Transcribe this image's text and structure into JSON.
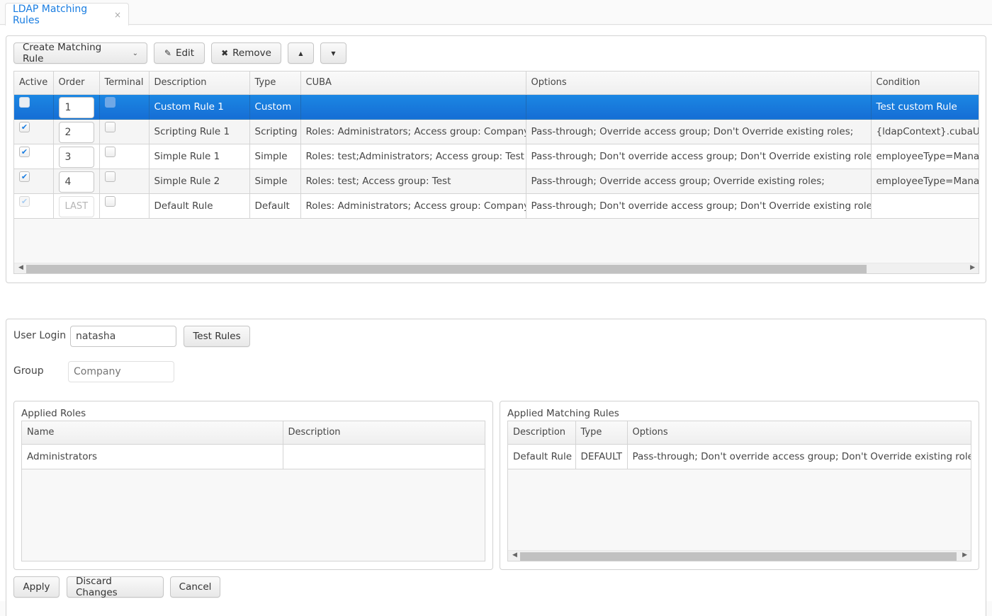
{
  "tab": {
    "label": "LDAP Matching Rules",
    "close_icon": "×"
  },
  "toolbar": {
    "create_label": "Create Matching Rule",
    "edit_label": "Edit",
    "remove_label": "Remove",
    "move_up_icon": "▲",
    "move_down_icon": "▼",
    "chevron_icon": "⌄",
    "pencil_icon": "✎",
    "x_icon": "✖"
  },
  "rules_table": {
    "columns": [
      "Active",
      "Order",
      "Terminal",
      "Description",
      "Type",
      "CUBA",
      "Options",
      "Condition"
    ],
    "rows": [
      {
        "active": false,
        "order": "1",
        "terminal": false,
        "description": "Custom Rule 1",
        "type": "Custom",
        "cuba": "",
        "options": "",
        "condition": "Test custom Rule",
        "selected": true
      },
      {
        "active": true,
        "order": "2",
        "terminal": false,
        "description": "Scripting Rule 1",
        "type": "Scripting",
        "cuba": "Roles: Administrators; Access group: Company",
        "options": "Pass-through; Override access group; Don't Override existing roles;",
        "condition": "{ldapContext}.cubaUser"
      },
      {
        "active": true,
        "order": "3",
        "terminal": false,
        "description": "Simple Rule 1",
        "type": "Simple",
        "cuba": "Roles: test;Administrators; Access group: Test",
        "options": "Pass-through; Don't override access group; Don't Override existing roles;",
        "condition": "employeeType=Manager"
      },
      {
        "active": true,
        "order": "4",
        "terminal": false,
        "description": "Simple Rule 2",
        "type": "Simple",
        "cuba": "Roles: test; Access group: Test",
        "options": "Pass-through; Override access group; Override existing roles;",
        "condition": "employeeType=Manager"
      },
      {
        "active": true,
        "order": "LAST",
        "terminal": false,
        "description": "Default Rule",
        "type": "Default",
        "cuba": "Roles: Administrators; Access group: Company",
        "options": "Pass-through; Don't override access group; Don't Override existing roles;",
        "condition": "",
        "disabled": true
      }
    ]
  },
  "test_form": {
    "user_login_label": "User Login",
    "user_login_value": "natasha",
    "test_rules_label": "Test Rules",
    "group_label": "Group",
    "group_placeholder": "Company"
  },
  "applied_roles": {
    "caption": "Applied Roles",
    "columns": [
      "Name",
      "Description"
    ],
    "rows": [
      {
        "name": "Administrators",
        "description": ""
      }
    ]
  },
  "applied_rules": {
    "caption": "Applied Matching Rules",
    "columns": [
      "Description",
      "Type",
      "Options"
    ],
    "rows": [
      {
        "description": "Default Rule",
        "type": "DEFAULT",
        "options": "Pass-through; Don't override access group; Don't Override existing roles;"
      }
    ]
  },
  "footer": {
    "apply_label": "Apply",
    "discard_label": "Discard Changes",
    "cancel_label": "Cancel"
  },
  "colors": {
    "accent": "#197de1",
    "selected_row": "#1b87e3"
  }
}
